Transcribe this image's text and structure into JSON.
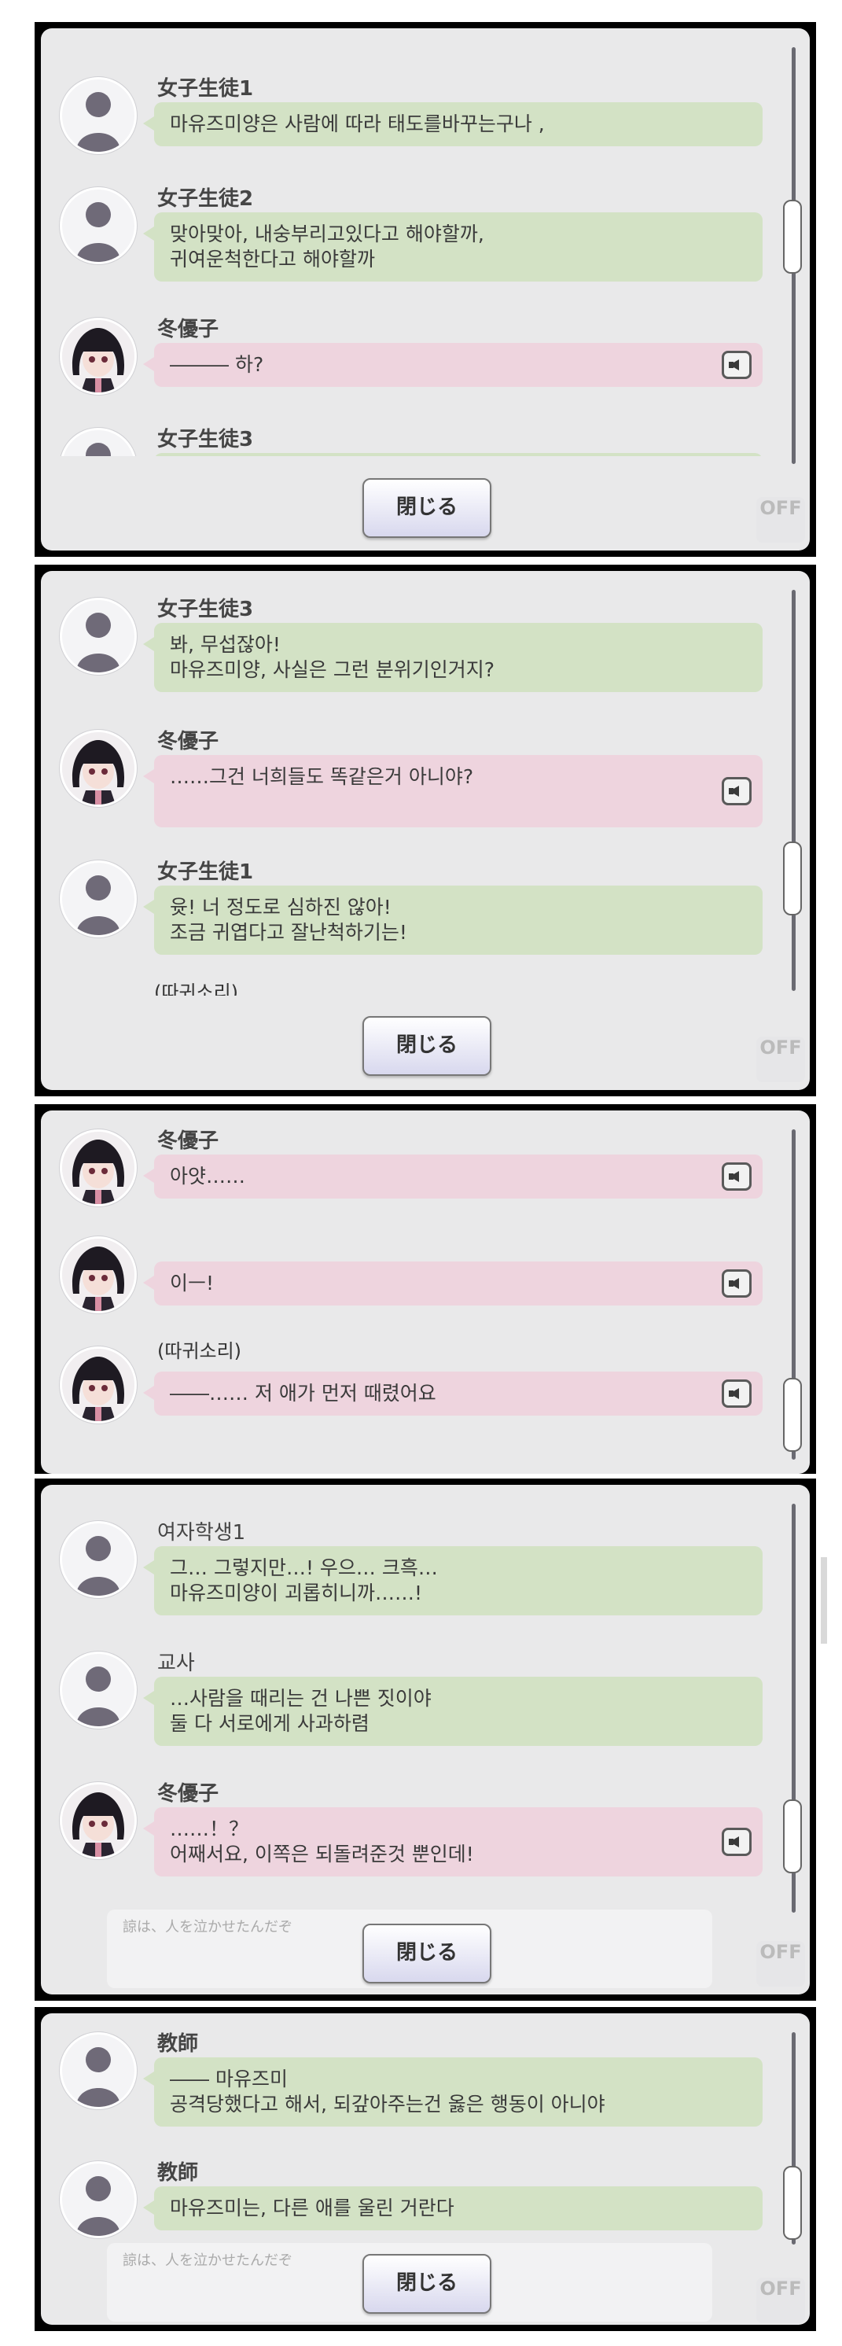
{
  "close_label": "閉じる",
  "auto_off": {
    "top": "",
    "label": "OFF"
  },
  "panel1": {
    "messages": [
      {
        "speaker": "女子生徒1",
        "text": "마유즈미양은 사람에 따라 태도를바꾸는구나 ,",
        "kind": "npc"
      },
      {
        "speaker": "女子生徒2",
        "text": "맞아맞아, 내숭부리고있다고 해야할까,\n귀여운척한다고 해야할까",
        "kind": "npc"
      },
      {
        "speaker": "冬優子",
        "text": "――― 하?",
        "kind": "fuyuko"
      },
      {
        "speaker": "女子生徒3",
        "text": "",
        "kind": "npc"
      }
    ]
  },
  "panel2": {
    "messages": [
      {
        "speaker": "女子生徒3",
        "text": "봐, 무섭잖아!\n마유즈미양, 사실은 그런 분위기인거지?",
        "kind": "npc"
      },
      {
        "speaker": "冬優子",
        "text": "……그건 너희들도 똑같은거 아니야?",
        "kind": "fuyuko"
      },
      {
        "speaker": "女子生徒1",
        "text": "윳! 너 정도로 심하진 않아!\n조금 귀엽다고 잘난척하기는!",
        "kind": "npc"
      }
    ],
    "sfx": "(따귀소리)"
  },
  "panel3": {
    "messages": [
      {
        "speaker": "冬優子",
        "text": "아얏……",
        "kind": "fuyuko"
      },
      {
        "speaker": "",
        "text": "이ㅡ!",
        "kind": "fuyuko"
      },
      {
        "speaker": "",
        "text": "――…… 저 애가 먼저 때렸어요",
        "kind": "fuyuko"
      }
    ],
    "sfx": "(따귀소리)"
  },
  "panel4": {
    "messages": [
      {
        "speaker": "여자학생1",
        "text": "그… 그렇지만…! 우으… 크흑…\n마유즈미양이 괴롭히니까……!",
        "kind": "npc"
      },
      {
        "speaker": "교사",
        "text": "…사람을 때리는 건 나쁜 짓이야\n둘 다 서로에게 사과하렴",
        "kind": "npc"
      },
      {
        "speaker": "冬優子",
        "text": "……！？\n어째서요, 이쪽은 되돌려준것 뿐인데!",
        "kind": "fuyuko"
      }
    ],
    "ghost": "諒は、人を泣かせたんだぞ"
  },
  "panel5": {
    "messages": [
      {
        "speaker": "教師",
        "text": "―― 마유즈미\n공격당했다고 해서, 되갚아주는건 옳은 행동이 아니야",
        "kind": "npc"
      },
      {
        "speaker": "教師",
        "text": "마유즈미는, 다른 애를 울린 거란다",
        "kind": "npc"
      }
    ],
    "ghost": "諒は、人を泣かせたんだぞ"
  }
}
